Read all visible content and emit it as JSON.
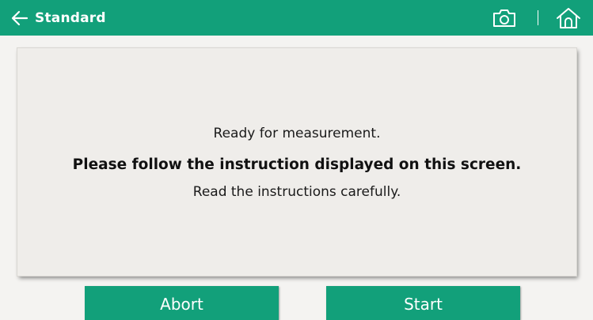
{
  "header": {
    "title": "Standard",
    "background_color": "#12a07a",
    "icons": {
      "back": "arrow-left-icon",
      "camera": "camera-icon",
      "home": "home-icon"
    }
  },
  "message": {
    "line1": "Ready for measurement.",
    "line2": "Please follow the instruction displayed on this screen.",
    "line3": "Read the instructions carefully."
  },
  "buttons": {
    "abort_label": "Abort",
    "start_label": "Start",
    "color": "#12a07a"
  }
}
